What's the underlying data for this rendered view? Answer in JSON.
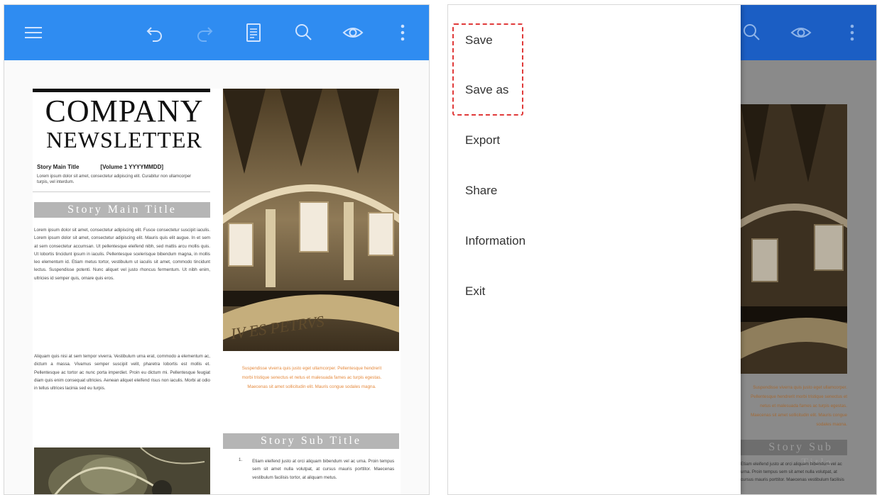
{
  "toolbar": {
    "color": "#2f8cf1",
    "icons": [
      "menu-icon",
      "undo-icon",
      "redo-icon",
      "document-icon",
      "search-icon",
      "eye-icon",
      "more-vert-icon"
    ]
  },
  "newsletter": {
    "title_line1": "COMPANY",
    "title_line2": "NEWSLETTER",
    "story_label": "Story Main Title",
    "volume": "[Volume 1 YYYYMMDD]",
    "intro": "Lorem ipsum dolor sit amet, consectetur adipiscing elit. Curabitur non ullamcorper turpis, vel interdum.",
    "main_banner": "Story Main Title",
    "paragraph1": "Lorem ipsum dolor sit amet, consectetur adipiscing elit. Fusce consectetur suscipit iaculis. Lorem ipsum dolor sit amet, consectetur adipiscing elit. Mauris quis elit augue. In et sem at sem consectetur accumsan. Ut pellentesque eleifend nibh, sed mattis arcu mollis quis. Ut lobortis tincidunt ipsum in iaculis. Pellentesque scelerisque bibendum magna, in mollis leo elementum id. Etiam metus tortor, vestibulum ut iaculis sit amet, commodo tincidunt lectus. Suspendisse potenti. Nunc aliquet vel justo rhoncus fermentum. Ut nibh enim, ultricies id semper quis, ornare quis eros.",
    "paragraph2": "Aliquam quis nisi at sem tempor viverra. Vestibulum urna erat, commodo a elementum ac, dictum a massa. Vivamus semper suscipit velit, pharetra lobortis est mollis et. Pellentesque ac tortor ac nunc porta imperdiet. Proin eu dictum mi. Pellentesque feugiat diam quis enim consequat ultricies. Aenean aliquet eleifend risus non iaculis. Morbi at odio in tellus ultrices lacinia sed eu turpis.",
    "quote": "Suspendisse viverra quis justo eget ullamcorper. Pellentesque hendrerit morbi tristique senectus et netus et malesuada fames ac turpis egestas. Maecenas sit amet sollicitudin elit. Mauris congue sodales magna.",
    "sub_banner": "Story Sub Title",
    "list_item": "Etiam eleifend justo at orci aliquam bibendum vel ac urna. Proin tempus sem sit amet nulla volutpat, at cursus mauris porttitor. Maecenas vestibulum facilisis tortor, at aliquam metus.",
    "dome_inscription": "IV ES PETRVS"
  },
  "menu": {
    "items": [
      "Save",
      "Save as",
      "Export",
      "Share",
      "Information",
      "Exit"
    ],
    "highlight_color": "#e03a3a"
  }
}
